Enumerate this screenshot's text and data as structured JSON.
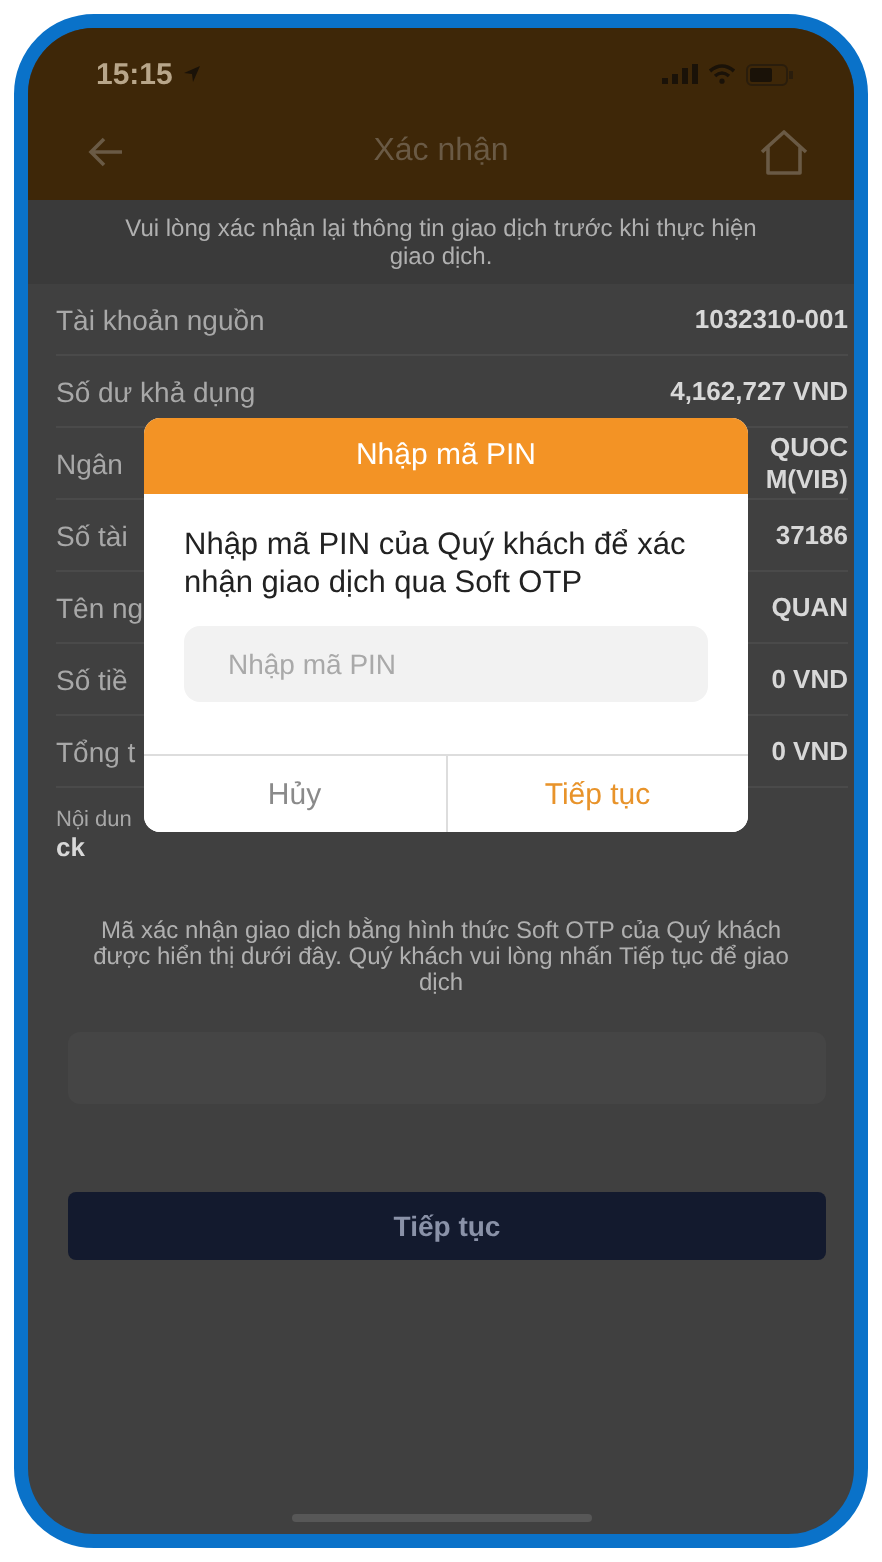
{
  "status_bar": {
    "time": "15:15"
  },
  "header": {
    "title": "Xác nhận"
  },
  "intro": "Vui lòng xác nhận lại thông tin giao dịch trước khi thực hiện giao dịch.",
  "details": [
    {
      "kind": "inline",
      "label": "Tài khoản nguồn",
      "value": "1032310-001"
    },
    {
      "kind": "inline",
      "label": "Số dư khả dụng",
      "value": "4,162,727 VND"
    },
    {
      "kind": "multiline",
      "label": "Ngân",
      "value_lines": [
        "QUOC",
        "M(VIB)"
      ]
    },
    {
      "kind": "inline",
      "label": "Số tài",
      "value": "37186"
    },
    {
      "kind": "inline",
      "label": "Tên ng",
      "value": "QUAN"
    },
    {
      "kind": "inline",
      "label": "Số tiề",
      "value": "0 VND"
    },
    {
      "kind": "inline",
      "label": "Tổng t",
      "value": "0 VND"
    },
    {
      "kind": "stacked",
      "label": "Nội dun",
      "value": "ck"
    }
  ],
  "otp_note": "Mã xác nhận giao dịch bằng hình thức Soft OTP của Quý khách được hiển thị dưới đây. Quý khách vui lòng nhấn Tiếp tục để giao dịch",
  "submit_button": {
    "label": "Tiếp tục"
  },
  "dialog": {
    "title": "Nhập mã PIN",
    "message": "Nhập mã PIN của Quý khách để xác nhận giao dịch qua Soft OTP",
    "pin_field": {
      "placeholder": "Nhập mã PIN"
    },
    "buttons": [
      {
        "kind": "cancel",
        "label": "Hủy"
      },
      {
        "kind": "confirm",
        "label": "Tiếp tục"
      }
    ]
  }
}
